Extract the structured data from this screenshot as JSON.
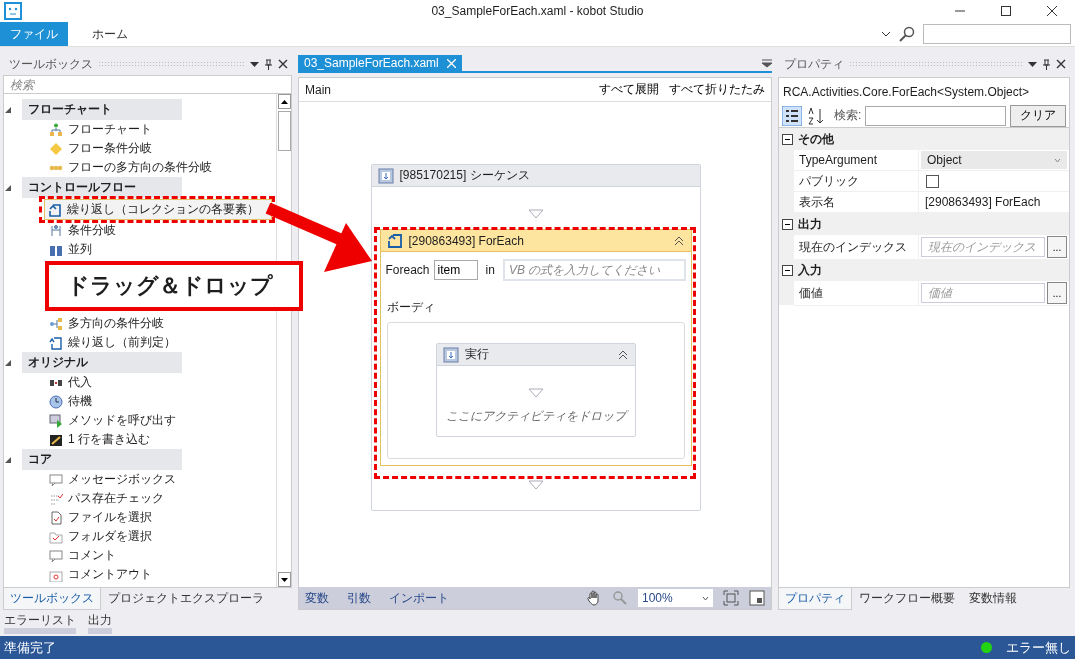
{
  "window": {
    "title": "03_SampleForEach.xaml - kobot Studio"
  },
  "menu_tabs": [
    {
      "label": "ファイル",
      "selected": true
    },
    {
      "label": "ホーム",
      "selected": false
    }
  ],
  "toolbox": {
    "title": "ツールボックス",
    "search": {
      "placeholder": "検索"
    },
    "groups": [
      {
        "label": "フローチャート",
        "expanded": true,
        "children": [
          {
            "label": "フローチャート",
            "kind": "flowchart",
            "selected": false
          },
          {
            "label": "フロー条件分岐",
            "kind": "decision",
            "selected": false
          },
          {
            "label": "フローの多方向の条件分岐",
            "kind": "switch",
            "selected": false
          }
        ]
      },
      {
        "label": "コントロールフロー",
        "expanded": true,
        "children": [
          {
            "label": "繰り返し（コレクションの各要素）",
            "kind": "foreach",
            "selected": true
          },
          {
            "label": "条件分岐",
            "kind": "if",
            "selected": false
          },
          {
            "label": "並列",
            "kind": "parallel",
            "selected": false
          },
          {
            "label": "多方向の条件分岐",
            "kind": "multiswitch",
            "selected": false
          },
          {
            "label": "繰り返し（前判定）",
            "kind": "while",
            "selected": false
          }
        ]
      },
      {
        "label": "オリジナル",
        "expanded": true,
        "children": [
          {
            "label": "代入",
            "kind": "assign",
            "selected": false
          },
          {
            "label": "待機",
            "kind": "delay",
            "selected": false
          },
          {
            "label": "メソッドを呼び出す",
            "kind": "invoke",
            "selected": false
          },
          {
            "label": "1 行を書き込む",
            "kind": "writeline",
            "selected": false
          }
        ]
      },
      {
        "label": "コア",
        "expanded": true,
        "children": [
          {
            "label": "メッセージボックス",
            "kind": "msgbox",
            "selected": false
          },
          {
            "label": "パス存在チェック",
            "kind": "pathcheck",
            "selected": false
          },
          {
            "label": "ファイルを選択",
            "kind": "selectfile",
            "selected": false
          },
          {
            "label": "フォルダを選択",
            "kind": "selectfolder",
            "selected": false
          },
          {
            "label": "コメント",
            "kind": "comment",
            "selected": false
          },
          {
            "label": "コメントアウト",
            "kind": "commentout",
            "selected": false
          }
        ]
      }
    ],
    "tabs": [
      {
        "label": "ツールボックス",
        "selected": true
      },
      {
        "label": "プロジェクトエクスプローラ",
        "selected": false
      }
    ]
  },
  "annotation": {
    "label": "ドラッグ＆ドロップ"
  },
  "designer": {
    "tab": {
      "label": "03_SampleForEach.xaml",
      "selected": true
    },
    "breadcrumb": "Main",
    "actions": [
      "すべて展開",
      "すべて折りたたみ"
    ],
    "sequence": {
      "title": "[985170215] シーケンス",
      "foreach": {
        "title": "[290863493] ForEach",
        "expanded": true,
        "foreach_label": "Foreach",
        "variable": "item",
        "in_label": "in",
        "expression": {
          "placeholder": "VB の式を入力してください"
        },
        "body_label": "ボーディ",
        "body": {
          "title": "実行",
          "expanded": true,
          "drop_hint": "ここにアクティビティをドロップ"
        }
      }
    },
    "bottom_tabs": [
      "変数",
      "引数",
      "インポート"
    ],
    "zoom": "100%"
  },
  "properties": {
    "title": "プロパティ",
    "type_name": "RCA.Activities.Core.ForEach<System.Object>",
    "search_label": "検索:",
    "clear_button": "クリア",
    "categories": [
      {
        "label": "その他",
        "expanded": true,
        "rows": [
          {
            "name": "TypeArgument",
            "kind": "dropdown",
            "value": "Object"
          },
          {
            "name": "パブリック",
            "kind": "checkbox",
            "checked": false
          },
          {
            "name": "表示名",
            "kind": "text",
            "value": "[290863493] ForEach"
          }
        ]
      },
      {
        "label": "出力",
        "expanded": true,
        "rows": [
          {
            "name": "現在のインデックス",
            "kind": "expression",
            "placeholder": "現在のインデックス",
            "button": "..."
          }
        ]
      },
      {
        "label": "入力",
        "expanded": true,
        "rows": [
          {
            "name": "価値",
            "kind": "expression",
            "placeholder": "価値",
            "button": "..."
          }
        ]
      }
    ],
    "tabs": [
      {
        "label": "プロパティ",
        "selected": true
      },
      {
        "label": "ワークフロー概要",
        "selected": false
      },
      {
        "label": "変数情報",
        "selected": false
      }
    ]
  },
  "output_tabs": [
    "エラーリスト",
    "出力"
  ],
  "status_bar": {
    "text": "準備完了",
    "errors": "エラー無し"
  }
}
